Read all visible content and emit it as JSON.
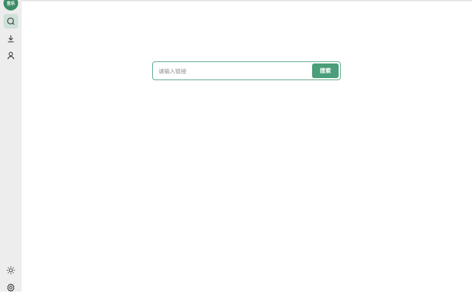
{
  "sidebar": {
    "logo_text": "音乐",
    "items": [
      {
        "name": "search",
        "icon": "search-icon",
        "active": true
      },
      {
        "name": "download",
        "icon": "download-icon",
        "active": false
      },
      {
        "name": "user",
        "icon": "user-icon",
        "active": false
      }
    ],
    "bottom_items": [
      {
        "name": "theme",
        "icon": "sun-icon"
      },
      {
        "name": "settings",
        "icon": "gear-icon"
      }
    ]
  },
  "search": {
    "placeholder": "请输入链接",
    "value": "",
    "button_label": "搜索"
  },
  "colors": {
    "accent": "#4a9e79",
    "sidebar_bg": "#ededed",
    "active_bg": "#cfe2d9"
  }
}
